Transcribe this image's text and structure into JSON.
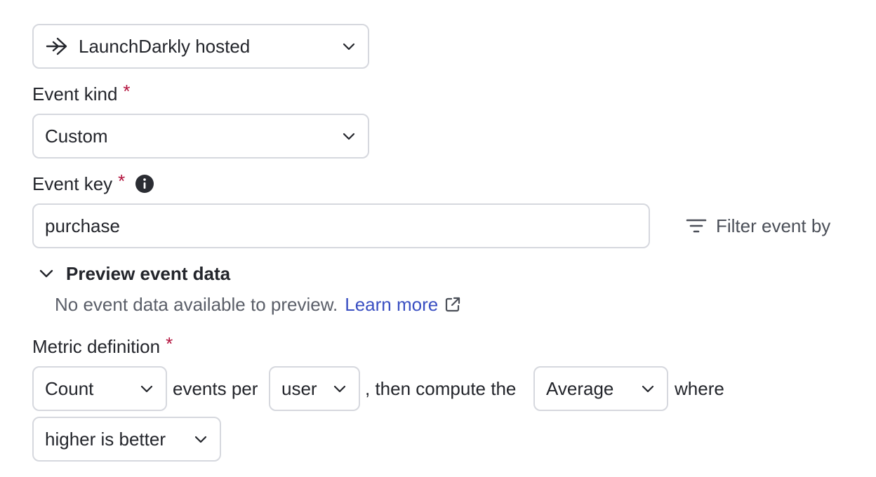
{
  "source_select": {
    "value": "LaunchDarkly hosted",
    "icon": "arrow-right-icon"
  },
  "event_kind": {
    "label": "Event kind",
    "required_mark": "*",
    "value": "Custom"
  },
  "event_key": {
    "label": "Event key",
    "required_mark": "*",
    "value": "purchase",
    "info_icon": "info-icon"
  },
  "filter": {
    "label": "Filter event by",
    "icon": "filter-icon"
  },
  "preview": {
    "toggle_label": "Preview event data",
    "empty_message": "No event data available to preview.",
    "learn_more": "Learn more"
  },
  "metric_definition": {
    "label": "Metric definition",
    "required_mark": "*",
    "aggregation": "Count",
    "text_events_per": "events per",
    "unit": "user",
    "text_then_compute": ", then compute the",
    "statistic": "Average",
    "text_where": "where",
    "success_criteria": "higher is better"
  }
}
